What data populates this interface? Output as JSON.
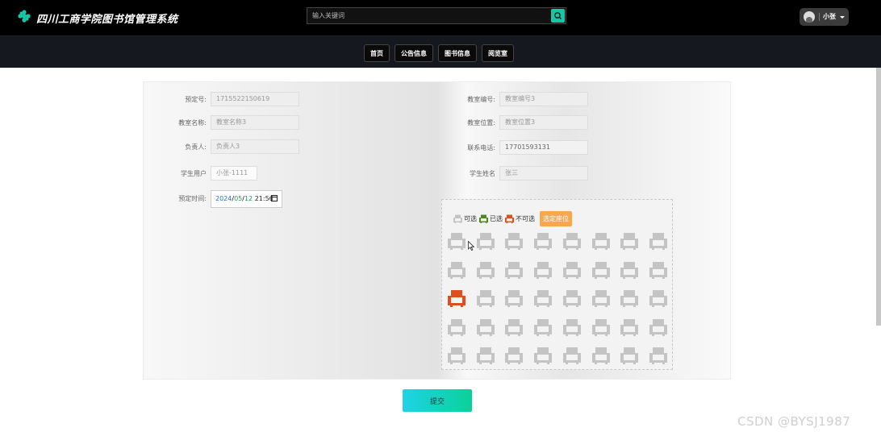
{
  "header": {
    "site_title": "四川工商学院图书馆管理系统",
    "search_placeholder": "输入关键词",
    "user_name": "小张"
  },
  "nav": [
    "首页",
    "公告信息",
    "图书信息",
    "阅览室"
  ],
  "form": {
    "reservation_no_label": "预定号:",
    "reservation_no": "1715522150619",
    "room_no_label": "教室编号:",
    "room_no": "教室编号3",
    "room_name_label": "教室名称:",
    "room_name": "教室名称3",
    "room_location_label": "教室位置:",
    "room_location": "教室位置3",
    "manager_label": "负责人:",
    "manager": "负责人3",
    "phone_label": "联系电话:",
    "phone": "17701593131",
    "student_user_label": "学生用户",
    "student_user": "小张-1111",
    "student_name_label": "学生姓名",
    "student_name": "张三",
    "reserve_time_label": "预定时间:",
    "reserve_date_year": "2024",
    "reserve_date_month": "05",
    "reserve_date_day": "12",
    "reserve_time": "21:56"
  },
  "seats": {
    "legend_available": "可选",
    "legend_selected": "已选",
    "legend_unavailable": "不可选",
    "select_button": "选定座位",
    "colors": {
      "available": "#c4c4c4",
      "selected": "#4e8a1e",
      "unavailable": "#e04e1c",
      "select_button": "#f7a848"
    },
    "rows": 5,
    "cols": 8,
    "unavailable_seats": [
      [
        2,
        0
      ]
    ]
  },
  "submit_label": "提交",
  "watermark": "CSDN @BYSJ1987"
}
